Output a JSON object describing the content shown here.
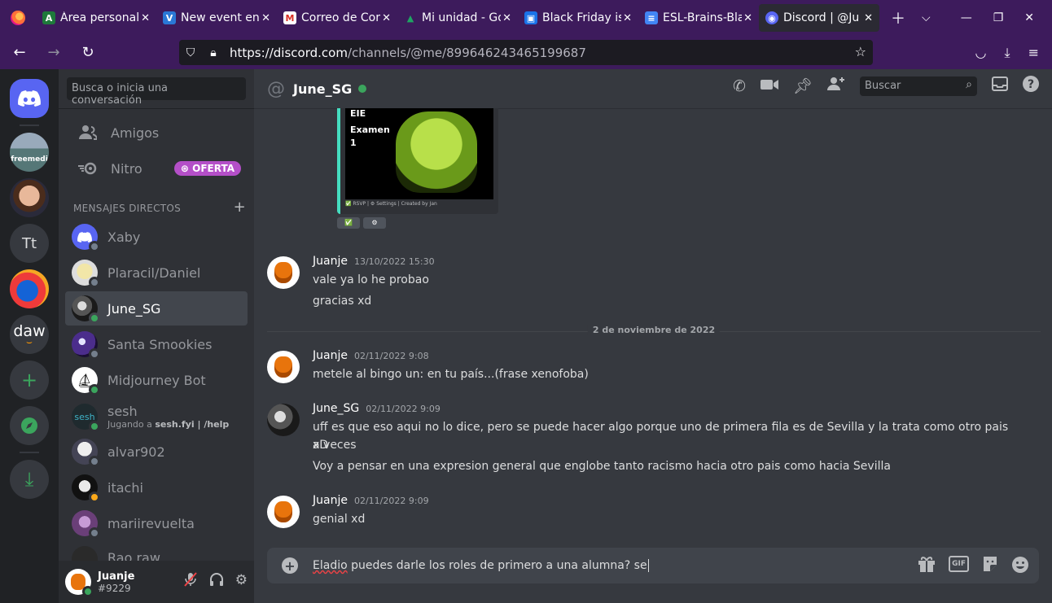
{
  "browser": {
    "tabs": [
      {
        "title": "Área personal",
        "fav_color": "#1e7a3b",
        "fav_glyph": "A"
      },
      {
        "title": "New event en",
        "fav_color": "#2a78d6",
        "fav_glyph": "V"
      },
      {
        "title": "Correo de Cor",
        "fav_color": "#ffffff",
        "fav_glyph": "M"
      },
      {
        "title": "Mi unidad - Go",
        "fav_color": "#ffffff",
        "fav_glyph": "▲"
      },
      {
        "title": "Black Friday is",
        "fav_color": "#1a73e8",
        "fav_glyph": "▣"
      },
      {
        "title": "ESL-Brains-Bla",
        "fav_color": "#4285f4",
        "fav_glyph": "≡"
      },
      {
        "title": "Discord | @Ju",
        "fav_color": "#5865f2",
        "fav_glyph": "◉"
      }
    ],
    "url_host": "https://discord.com",
    "url_path": "/channels/@me/899646243465199687"
  },
  "sidebar": {
    "search_placeholder": "Busca o inicia una conversación",
    "friends_label": "Amigos",
    "nitro_label": "Nitro",
    "nitro_badge": "OFERTA",
    "dm_header": "MENSAJES DIRECTOS",
    "dms": [
      {
        "name": "Xaby",
        "status_color": "#747f8d"
      },
      {
        "name": "Plaracil/Daniel",
        "status_color": "#747f8d"
      },
      {
        "name": "June_SG",
        "status_color": "#3ba55d"
      },
      {
        "name": "Santa Smookies",
        "status_color": "#747f8d"
      },
      {
        "name": "Midjourney Bot",
        "status_color": "#3ba55d"
      },
      {
        "name": "sesh",
        "sub_prefix": "Jugando a ",
        "sub_bold": "sesh.fyi | /help",
        "status_color": "#3ba55d"
      },
      {
        "name": "alvar902",
        "status_color": "#747f8d"
      },
      {
        "name": "itachi",
        "status_color": "#faa81a"
      },
      {
        "name": "mariirevuelta",
        "status_color": "#747f8d"
      },
      {
        "name": "Rao raw",
        "status_color": "#747f8d"
      }
    ],
    "user": {
      "name": "Juanje",
      "tag": "#9229"
    }
  },
  "guilds": {
    "text_server": "Tt",
    "daw_server": "daw",
    "meme_label": "freemedi"
  },
  "chat": {
    "title": "June_SG",
    "search_placeholder": "Buscar",
    "embed": {
      "line1": "EIE",
      "line2": "Examen",
      "line3": "1",
      "footer": "✅ RSVP | ⚙ Settings | Created by Jan"
    },
    "messages": [
      {
        "author": "Juanje",
        "time": "13/10/2022 15:30",
        "lines": [
          "vale ya lo he probao",
          "gracias xd"
        ]
      },
      {
        "author": "Juanje",
        "time": "02/11/2022 9:08",
        "lines": [
          "metele al bingo un: en tu país...(frase xenofoba)"
        ]
      },
      {
        "author": "June_SG",
        "time": "02/11/2022 9:09",
        "lines": [
          "uff es que eso aqui no lo dice, pero se puede hacer algo porque uno de primera fila es de Sevilla y la trata como otro pais a veces",
          "xD",
          "Voy a pensar en una expresion general que englobe tanto racismo hacia otro pais como hacia Sevilla"
        ]
      },
      {
        "author": "Juanje",
        "time": "02/11/2022 9:09",
        "lines": [
          "genial xd"
        ]
      }
    ],
    "date_divider": "2 de noviembre de 2022",
    "composer_error_word": "Eladio",
    "composer_text": " puedes darle los roles de primero a una alumna? se"
  }
}
